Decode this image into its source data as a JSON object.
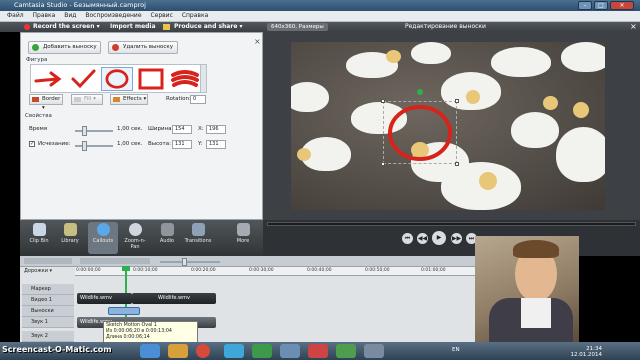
{
  "window": {
    "title": "Camtasia Studio - Безымянный.camproj",
    "controls": {
      "minimize": "–",
      "maximize": "□",
      "close": "✕"
    }
  },
  "menu": [
    "Файл",
    "Правка",
    "Вид",
    "Воспроизведение",
    "Сервис",
    "Справка"
  ],
  "toolbar": {
    "record_label": "Record the screen ▾",
    "import_label": "Import media",
    "produce_label": "Produce and share ▾"
  },
  "left_panel": {
    "add_callout_label": "Добавить выноску",
    "delete_callout_label": "Удалить выноску",
    "close_glyph": "×",
    "shape_section_label": "Фигура",
    "border_label": "Border ▾",
    "fill_label": "Fill ▾",
    "effects_label": "Effects ▾",
    "rotation_label": "Rotation:",
    "rotation_value": "0",
    "properties_label": "Свойства",
    "time_label": "Время",
    "time_value": "1,00 сек.",
    "width_label": "Ширина:",
    "width_value": "154",
    "x_label": "X:",
    "x_value": "196",
    "fade_label": "Исчезание:",
    "fade_value": "1,00 сек.",
    "height_label": "Высота:",
    "height_value": "131",
    "y_label": "Y:",
    "y_value": "131"
  },
  "preview": {
    "size_dropdown": "640x360, Размеры",
    "title": "Редактирование выноски",
    "close_glyph": "×",
    "playback_buttons": [
      "⏮",
      "◀◀",
      "▶",
      "▶▶",
      "⏭"
    ]
  },
  "tool_tabs": [
    {
      "label": "Clip Bin",
      "color": "#c9d6e3"
    },
    {
      "label": "Library",
      "color": "#c7bf7f"
    },
    {
      "label": "Callouts",
      "color": "#5aa8e8"
    },
    {
      "label": "Zoom-n-Pan",
      "color": "#cfd6dd"
    },
    {
      "label": "Audio",
      "color": "#8f959a"
    },
    {
      "label": "Transitions",
      "color": "#8fa2b5"
    },
    {
      "label": "More",
      "color": "#a4abb2"
    }
  ],
  "timeline": {
    "tracks_label": "Дорожки ▾",
    "marker_label": "Маркер",
    "video1_label": "Видео 1",
    "callouts_label": "Выноски",
    "audio1_label": "Звук 1",
    "audio2_label": "Звук 2",
    "ticks": [
      "0:00:00;00",
      "0:00:10;00",
      "0:00:20;00",
      "0:00:30;00",
      "0:00:40;00",
      "0:00:50;00",
      "0:01:00;00",
      "0:01:10;00"
    ],
    "clip_video_a": "Wildlife.wmv",
    "clip_video_b": "Wildlife.wmv",
    "clip_audio": "Wildlife.wmv",
    "tooltip_line1": "Sketch Motion Oval 1",
    "tooltip_line2": "Из 0:00:06;20 в 0:00:13;04",
    "tooltip_line3": "Длина 0:00:06;14"
  },
  "taskbar": {
    "watermark": "Screencast-O-Matic.com",
    "lang": "EN",
    "time": "21:34",
    "date": "12.01.2014"
  },
  "colors": {
    "callout_red": "#d8231b",
    "selection_green": "#2db24b"
  }
}
